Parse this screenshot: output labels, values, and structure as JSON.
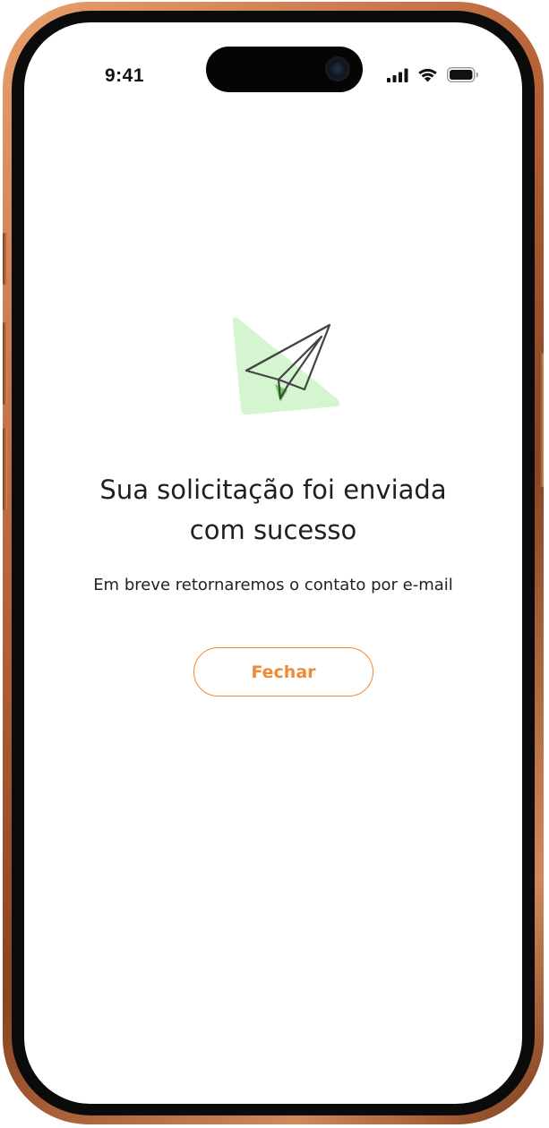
{
  "status_bar": {
    "time": "9:41",
    "icons": [
      "cellular-signal-icon",
      "wifi-icon",
      "battery-icon"
    ]
  },
  "illustration": {
    "icon": "paper-plane-icon",
    "accent_color": "#d4f5cf",
    "highlight_color": "#6cd35a"
  },
  "message": {
    "title_line1": "Sua solicitação foi enviada",
    "title_line2": "com sucesso",
    "subtitle": "Em breve retornaremos o contato por e-mail"
  },
  "actions": {
    "close_label": "Fechar",
    "close_color": "#ef8a34"
  }
}
